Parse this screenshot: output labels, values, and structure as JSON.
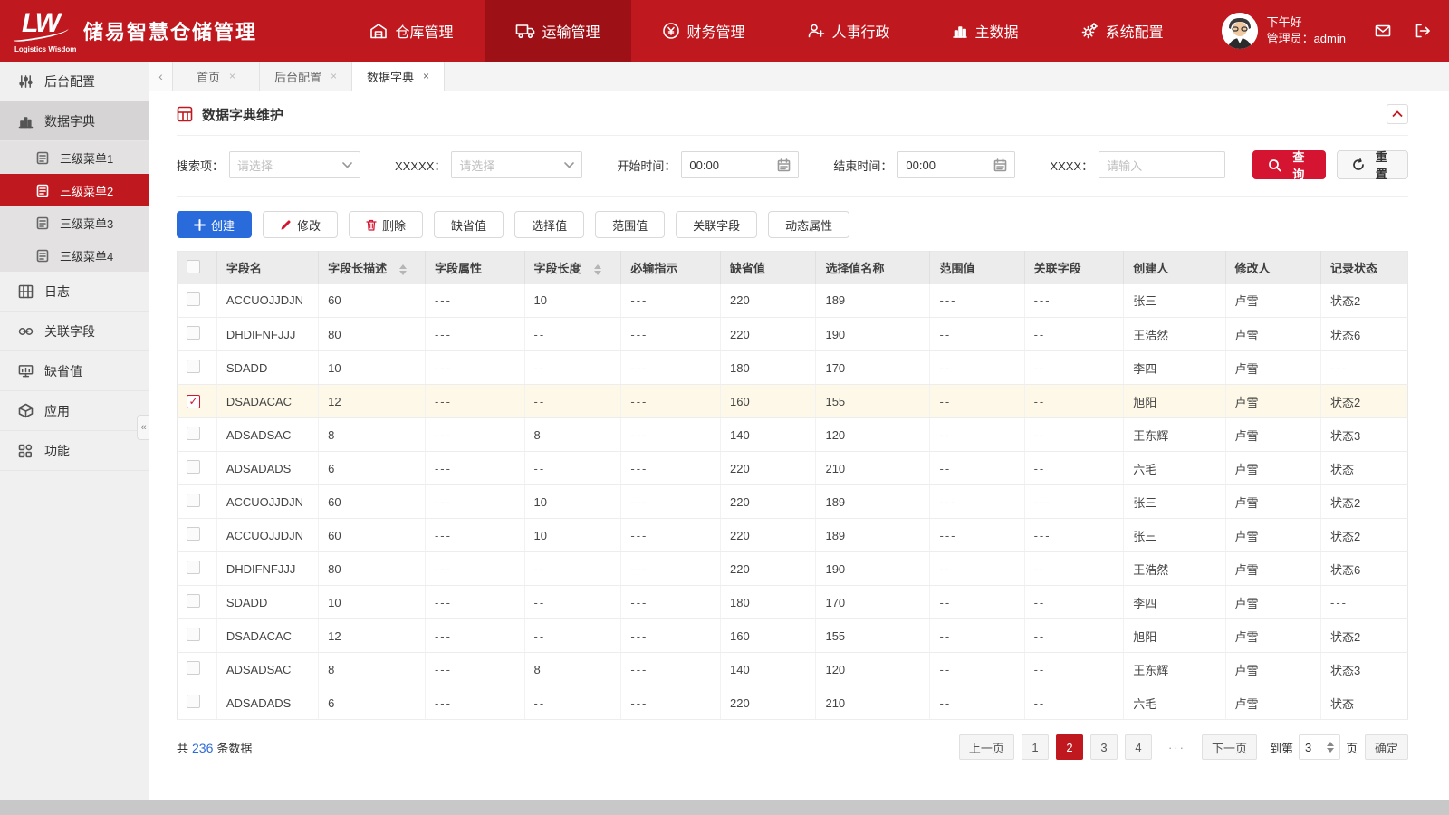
{
  "header": {
    "logo_text": "LW",
    "logo_subtext": "Logistics Wisdom",
    "app_title": "储易智慧仓储管理",
    "nav": [
      {
        "label": "仓库管理",
        "icon": "warehouse-icon",
        "active": false
      },
      {
        "label": "运输管理",
        "icon": "truck-icon",
        "active": true
      },
      {
        "label": "财务管理",
        "icon": "finance-icon",
        "active": false
      },
      {
        "label": "人事行政",
        "icon": "hr-icon",
        "active": false
      },
      {
        "label": "主数据",
        "icon": "master-data-icon",
        "active": false
      },
      {
        "label": "系统配置",
        "icon": "system-config-icon",
        "active": false
      }
    ],
    "user": {
      "greeting": "下午好",
      "role": "管理员：admin"
    },
    "actions": [
      {
        "name": "mail-button",
        "icon": "mail-icon"
      },
      {
        "name": "logout-button",
        "icon": "logout-icon"
      }
    ]
  },
  "sidebar": {
    "collapse_glyph": "«",
    "items": [
      {
        "label": "后台配置",
        "icon": "sliders-icon",
        "type": "parent",
        "active": false
      },
      {
        "label": "数据字典",
        "icon": "bar-chart-icon",
        "type": "parent",
        "active": true
      },
      {
        "label": "三级菜单1",
        "icon": "document-icon",
        "type": "sub",
        "active": false
      },
      {
        "label": "三级菜单2",
        "icon": "document-icon",
        "type": "sub",
        "active": true
      },
      {
        "label": "三级菜单3",
        "icon": "document-icon",
        "type": "sub",
        "active": false
      },
      {
        "label": "三级菜单4",
        "icon": "document-icon",
        "type": "sub",
        "active": false
      },
      {
        "label": "日志",
        "icon": "grid-icon",
        "type": "parent",
        "active": false
      },
      {
        "label": "关联字段",
        "icon": "link-icon",
        "type": "parent",
        "active": false
      },
      {
        "label": "缺省值",
        "icon": "monitor-icon",
        "type": "parent",
        "active": false
      },
      {
        "label": "应用",
        "icon": "box-icon",
        "type": "parent",
        "active": false
      },
      {
        "label": "功能",
        "icon": "components-icon",
        "type": "parent",
        "active": false
      }
    ]
  },
  "tabs": {
    "scroll_left_glyph": "‹",
    "items": [
      {
        "label": "首页",
        "active": false
      },
      {
        "label": "后台配置",
        "active": false
      },
      {
        "label": "数据字典",
        "active": true
      }
    ]
  },
  "panel": {
    "title": "数据字典维护",
    "filters": [
      {
        "label": "搜索项：",
        "type": "select",
        "placeholder": "请选择"
      },
      {
        "label": "XXXXX：",
        "type": "select",
        "placeholder": "请选择"
      },
      {
        "label": "开始时间：",
        "type": "time",
        "value": "00:00"
      },
      {
        "label": "结束时间：",
        "type": "time",
        "value": "00:00"
      },
      {
        "label": "XXXX：",
        "type": "text",
        "placeholder": "请输入"
      }
    ],
    "search_button": "查询",
    "reset_button": "重置",
    "toolbar": [
      {
        "label": "创建",
        "icon": "plus-icon",
        "style": "primary"
      },
      {
        "label": "修改",
        "icon": "pencil-icon",
        "style": "default"
      },
      {
        "label": "删除",
        "icon": "trash-icon",
        "style": "default"
      },
      {
        "label": "缺省值",
        "style": "default"
      },
      {
        "label": "选择值",
        "style": "default"
      },
      {
        "label": "范围值",
        "style": "default"
      },
      {
        "label": "关联字段",
        "style": "default"
      },
      {
        "label": "动态属性",
        "style": "default"
      }
    ]
  },
  "table": {
    "columns": [
      {
        "label": "字段名",
        "sortable": false
      },
      {
        "label": "字段长描述",
        "sortable": true
      },
      {
        "label": "字段属性",
        "sortable": false
      },
      {
        "label": "字段长度",
        "sortable": true
      },
      {
        "label": "必输指示",
        "sortable": false
      },
      {
        "label": "缺省值",
        "sortable": false
      },
      {
        "label": "选择值名称",
        "sortable": false
      },
      {
        "label": "范围值",
        "sortable": false
      },
      {
        "label": "关联字段",
        "sortable": false
      },
      {
        "label": "创建人",
        "sortable": false
      },
      {
        "label": "修改人",
        "sortable": false
      },
      {
        "label": "记录状态",
        "sortable": false
      }
    ],
    "rows": [
      {
        "checked": false,
        "cells": [
          "ACCUOJJDJN",
          "60",
          "---",
          "10",
          "---",
          "220",
          "189",
          "---",
          "---",
          "张三",
          "卢雪",
          "状态2"
        ]
      },
      {
        "checked": false,
        "cells": [
          "DHDIFNFJJJ",
          "80",
          "---",
          "--",
          "---",
          "220",
          "190",
          "--",
          "--",
          "王浩然",
          "卢雪",
          "状态6"
        ]
      },
      {
        "checked": false,
        "cells": [
          "SDADD",
          "10",
          "---",
          "--",
          "---",
          "180",
          "170",
          "--",
          "--",
          "李四",
          "卢雪",
          "---"
        ]
      },
      {
        "checked": true,
        "cells": [
          "DSADACAC",
          "12",
          "---",
          "--",
          "---",
          "160",
          "155",
          "--",
          "--",
          "旭阳",
          "卢雪",
          "状态2"
        ]
      },
      {
        "checked": false,
        "cells": [
          "ADSADSAC",
          "8",
          "---",
          "8",
          "---",
          "140",
          "120",
          "--",
          "--",
          "王东辉",
          "卢雪",
          "状态3"
        ]
      },
      {
        "checked": false,
        "cells": [
          "ADSADADS",
          "6",
          "---",
          "--",
          "---",
          "220",
          "210",
          "--",
          "--",
          "六毛",
          "卢雪",
          "状态"
        ]
      },
      {
        "checked": false,
        "cells": [
          "ACCUOJJDJN",
          "60",
          "---",
          "10",
          "---",
          "220",
          "189",
          "---",
          "---",
          "张三",
          "卢雪",
          "状态2"
        ]
      },
      {
        "checked": false,
        "cells": [
          "ACCUOJJDJN",
          "60",
          "---",
          "10",
          "---",
          "220",
          "189",
          "---",
          "---",
          "张三",
          "卢雪",
          "状态2"
        ]
      },
      {
        "checked": false,
        "cells": [
          "DHDIFNFJJJ",
          "80",
          "---",
          "--",
          "---",
          "220",
          "190",
          "--",
          "--",
          "王浩然",
          "卢雪",
          "状态6"
        ]
      },
      {
        "checked": false,
        "cells": [
          "SDADD",
          "10",
          "---",
          "--",
          "---",
          "180",
          "170",
          "--",
          "--",
          "李四",
          "卢雪",
          "---"
        ]
      },
      {
        "checked": false,
        "cells": [
          "DSADACAC",
          "12",
          "---",
          "--",
          "---",
          "160",
          "155",
          "--",
          "--",
          "旭阳",
          "卢雪",
          "状态2"
        ]
      },
      {
        "checked": false,
        "cells": [
          "ADSADSAC",
          "8",
          "---",
          "8",
          "---",
          "140",
          "120",
          "--",
          "--",
          "王东辉",
          "卢雪",
          "状态3"
        ]
      },
      {
        "checked": false,
        "cells": [
          "ADSADADS",
          "6",
          "---",
          "--",
          "---",
          "220",
          "210",
          "--",
          "--",
          "六毛",
          "卢雪",
          "状态"
        ]
      }
    ]
  },
  "footer": {
    "total_prefix": "共",
    "total_count": "236",
    "total_suffix": "条数据",
    "pagination": {
      "prev": "上一页",
      "pages": [
        "1",
        "2",
        "3",
        "4"
      ],
      "active_page": "2",
      "ellipsis": "···",
      "next": "下一页",
      "goto_prefix": "到第",
      "goto_value": "3",
      "goto_suffix": "页",
      "confirm": "确定"
    }
  },
  "colors": {
    "brand_red": "#c0181f",
    "nav_active_red": "#9c1016",
    "query_red": "#d41430",
    "primary_blue": "#2a6bdb",
    "link_blue": "#2f6bd8",
    "selected_row": "#fdf8e7"
  }
}
